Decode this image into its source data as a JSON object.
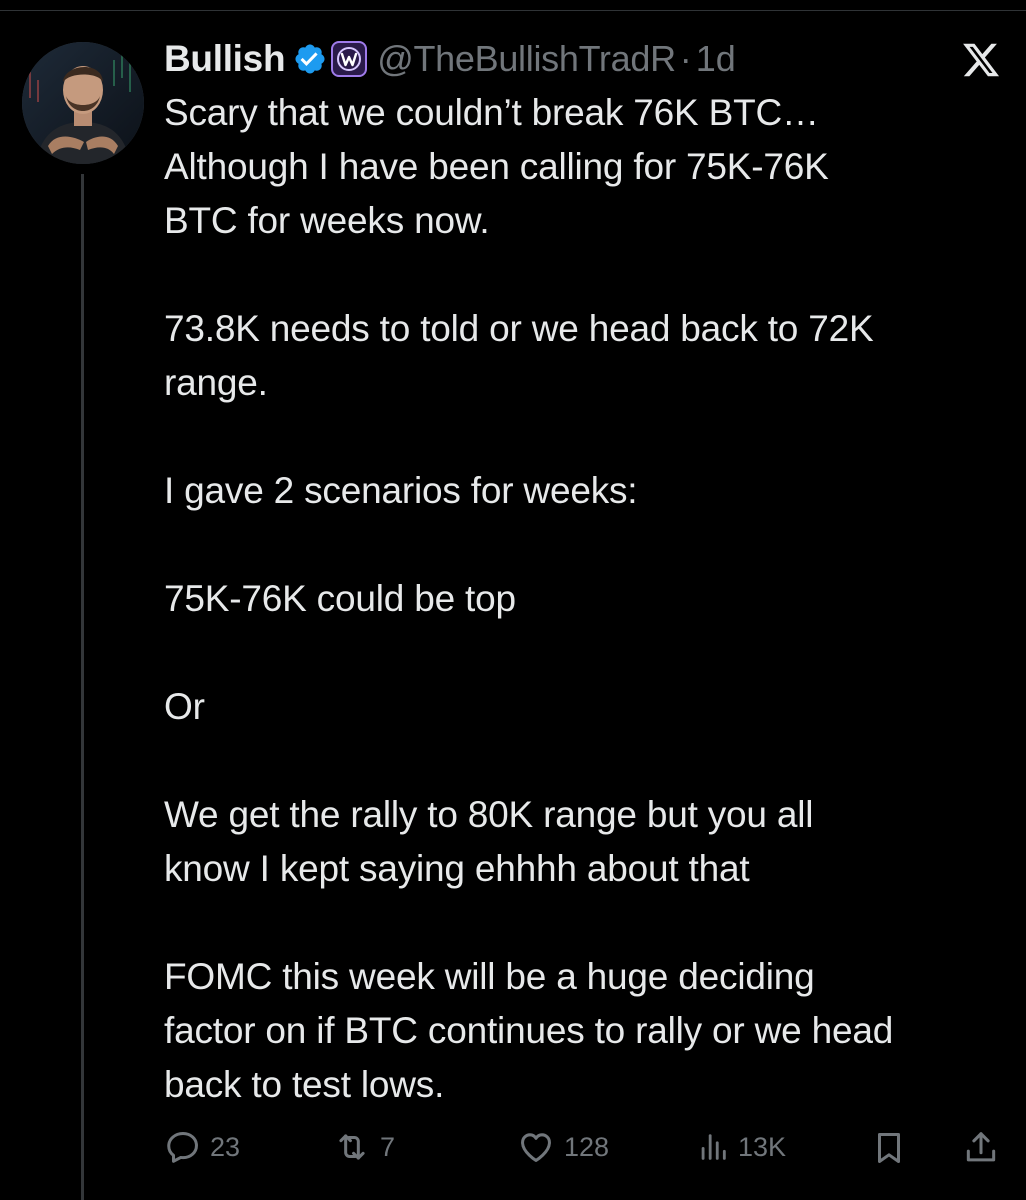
{
  "tweet": {
    "display_name": "Bullish",
    "handle": "@TheBullishTradR",
    "separator": "·",
    "time": "1d",
    "paragraphs": [
      "Scary that we couldn’t break 76K BTC…\nAlthough I have been calling for 75K-76K\nBTC for weeks now.",
      "73.8K needs to told or we head back to 72K\nrange.",
      "I gave 2 scenarios for weeks:",
      "75K-76K could be top",
      "Or",
      "We get the rally to 80K range but you all\nknow I kept saying ehhhh about that",
      "FOMC this week will be a huge deciding\nfactor on if BTC continues to rally or we head\nback to test lows."
    ]
  },
  "actions": {
    "replies": "23",
    "reposts": "7",
    "likes": "128",
    "views": "13K"
  },
  "icons": {
    "verified": "verified-badge-icon",
    "affiliate": "affiliate-badge-icon",
    "brand": "x-logo-icon",
    "reply": "reply-icon",
    "repost": "repost-icon",
    "like": "heart-icon",
    "views": "views-icon",
    "bookmark": "bookmark-icon",
    "share": "share-icon"
  },
  "colors": {
    "background": "#000000",
    "text": "#e7e9ea",
    "secondary": "#71767b",
    "verified_blue": "#1d9bf0",
    "affiliate_purple": "#7b4fd6"
  }
}
